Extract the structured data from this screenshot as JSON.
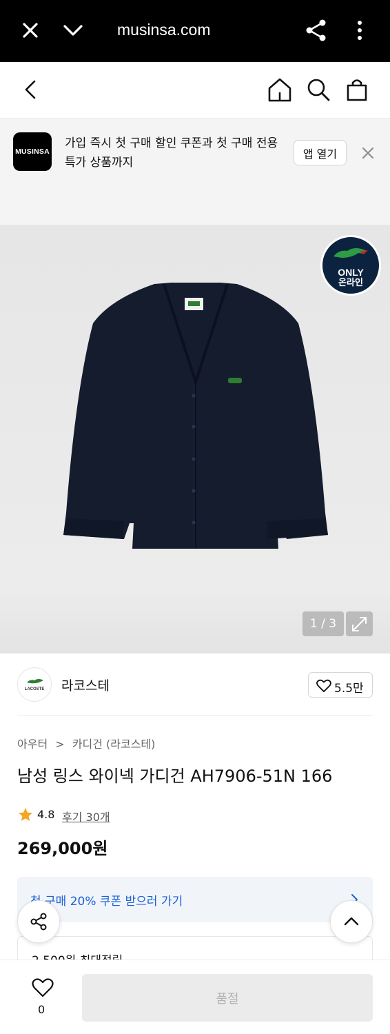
{
  "browser": {
    "url": "musinsa.com",
    "icons": [
      "close-icon",
      "chevron-down-icon",
      "share-icon",
      "more-vertical-icon"
    ]
  },
  "header": {
    "icons": [
      "back-arrow-icon",
      "home-icon",
      "search-icon",
      "shopping-bag-icon"
    ]
  },
  "banner": {
    "logo_text": "MUSINSA",
    "message": "가입 즉시 첫 구매 할인 쿠폰과 첫 구매 전용 특가 상품까지",
    "open_app_label": "앱 열기"
  },
  "gallery": {
    "badge_line1": "ONLY",
    "badge_line2": "온라인",
    "counter": "1 / 3"
  },
  "brand": {
    "logo_text": "LACOSTE",
    "name": "라코스테",
    "likes": "5.5만"
  },
  "product": {
    "breadcrumb": [
      "아우터",
      "카디건 (라코스테)"
    ],
    "breadcrumb_separator": ">",
    "title": "남성 링스 와이넥 가디건 AH7906-51N 166",
    "rating": "4.8",
    "reviews": "후기 30개",
    "price": "269,000원"
  },
  "coupon": {
    "text": "첫 구매 20% 쿠폰 받으러 가기"
  },
  "points": {
    "text": "2,500원 최대적립"
  },
  "bottom_bar": {
    "wish_count": "0",
    "buy_label": "품절"
  },
  "colors": {
    "accent_blue": "#1c62d8",
    "star": "#f5a623",
    "cardigan_navy": "#141c2e",
    "lacoste_green": "#2e7d32"
  }
}
